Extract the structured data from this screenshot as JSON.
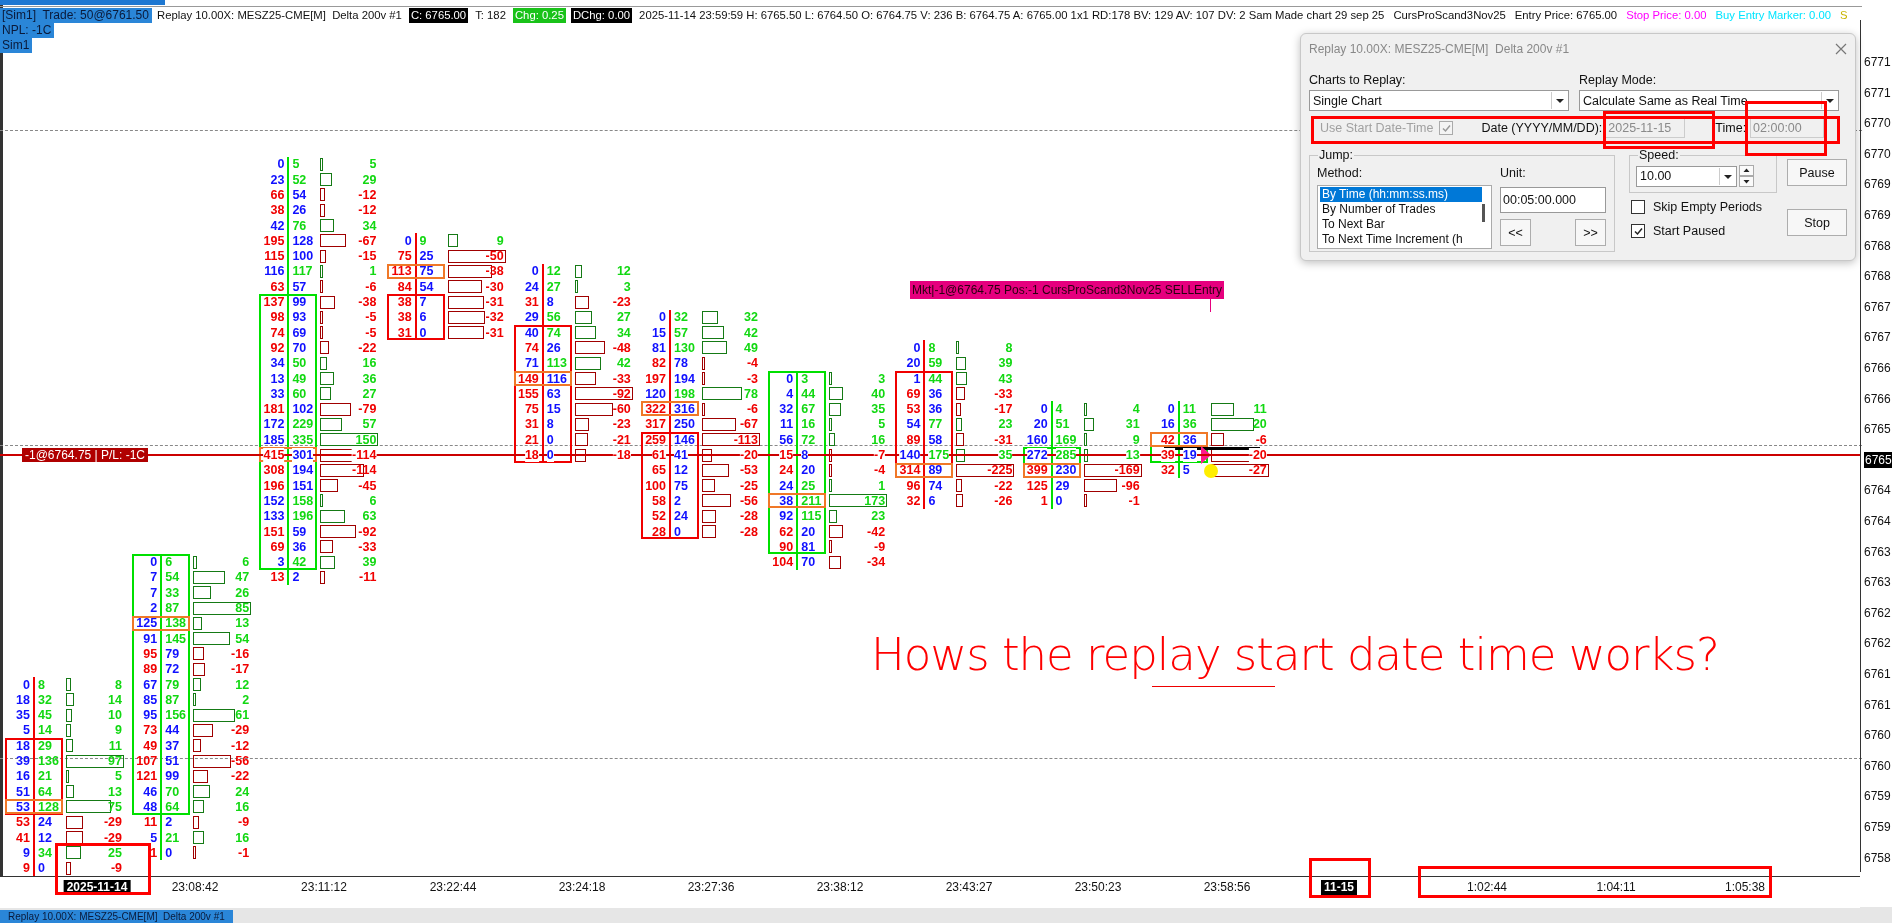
{
  "header": {
    "account": "[Sim1]  Trade: 50@6761.50",
    "npl": "NPL: -1C",
    "sim": "Sim1"
  },
  "info_line": [
    {
      "kind": "plain",
      "text": "Replay 10.00X: MESZ25-CME[M]  Delta 200v #1"
    },
    {
      "kind": "dark",
      "text": "C: 6765.00"
    },
    {
      "kind": "plain",
      "text": "T: 182"
    },
    {
      "kind": "up",
      "text": "Chg: 0.25"
    },
    {
      "kind": "dark",
      "text": "DChg: 0.00"
    },
    {
      "kind": "plain",
      "text": "2025-11-14 23:59:59 H: 6765.50 L: 6764.50 O: 6764.75 V: 236 B: 6764.75 A: 6765.00 1x1 RD:178 BV: 129 AV: 107 DV: 2 Sam Made chart 29 sep 25"
    },
    {
      "kind": "plain",
      "text": "CursProScand3Nov25"
    },
    {
      "kind": "plain",
      "text": "Entry Price: 6765.00"
    },
    {
      "kind": "tinted",
      "color": "#ff00ff",
      "text": "Stop Price: 0.00"
    },
    {
      "kind": "tinted",
      "color": "#00e5ff",
      "text": "Buy Entry Marker: 0.00"
    },
    {
      "kind": "tinted",
      "color": "#c8b400",
      "text": "S"
    }
  ],
  "price_axis": [
    {
      "kind": "label",
      "text": "6771"
    },
    {
      "kind": "label",
      "text": "6771"
    },
    {
      "kind": "label",
      "text": "6770"
    },
    {
      "kind": "label",
      "text": "6770"
    },
    {
      "kind": "label",
      "text": "6769"
    },
    {
      "kind": "label",
      "text": "6769"
    },
    {
      "kind": "label",
      "text": "6768"
    },
    {
      "kind": "label",
      "text": "6768"
    },
    {
      "kind": "label",
      "text": "6767"
    },
    {
      "kind": "label",
      "text": "6767"
    },
    {
      "kind": "label",
      "text": "6766"
    },
    {
      "kind": "label",
      "text": "6766"
    },
    {
      "kind": "label",
      "text": "6765"
    },
    {
      "kind": "current",
      "text": "6765"
    },
    {
      "kind": "label",
      "text": "6764"
    },
    {
      "kind": "label",
      "text": "6764"
    },
    {
      "kind": "label",
      "text": "6763"
    },
    {
      "kind": "label",
      "text": "6763"
    },
    {
      "kind": "label",
      "text": "6762"
    },
    {
      "kind": "label",
      "text": "6762"
    },
    {
      "kind": "label",
      "text": "6761"
    },
    {
      "kind": "label",
      "text": "6761"
    },
    {
      "kind": "label",
      "text": "6760"
    },
    {
      "kind": "label",
      "text": "6760"
    },
    {
      "kind": "label",
      "text": "6759"
    },
    {
      "kind": "label",
      "text": "6759"
    },
    {
      "kind": "label",
      "text": "6758"
    }
  ],
  "bars": [
    {
      "rising": false,
      "rows": [
        {
          "kind": "wick",
          "bid": "0",
          "ask": "8",
          "delta": "8"
        },
        {
          "kind": "wick",
          "bid": "18",
          "ask": "32",
          "delta": "14"
        },
        {
          "kind": "wick",
          "bid": "35",
          "ask": "45",
          "delta": "10"
        },
        {
          "kind": "wick",
          "bid": "5",
          "ask": "14",
          "delta": "9"
        },
        {
          "kind": "body",
          "bid": "18",
          "ask": "29",
          "delta": "11"
        },
        {
          "kind": "body",
          "bid": "39",
          "ask": "136",
          "delta": "97"
        },
        {
          "kind": "body",
          "bid": "16",
          "ask": "21",
          "delta": "5"
        },
        {
          "kind": "body",
          "bid": "51",
          "ask": "64",
          "delta": "13"
        },
        {
          "kind": "body_poc",
          "bid": "53",
          "ask": "128",
          "delta": "75"
        },
        {
          "kind": "wick",
          "bid": "53",
          "ask": "24",
          "delta": "-29"
        },
        {
          "kind": "wick",
          "bid": "41",
          "ask": "12",
          "delta": "-29"
        },
        {
          "kind": "wick",
          "bid": "9",
          "ask": "34",
          "delta": "25"
        },
        {
          "kind": "wick",
          "bid": "9",
          "ask": "0",
          "delta": "-9"
        }
      ]
    },
    {
      "rising": true,
      "rows": [
        {
          "kind": "body",
          "bid": "0",
          "ask": "6",
          "delta": "6"
        },
        {
          "kind": "body",
          "bid": "7",
          "ask": "54",
          "delta": "47"
        },
        {
          "kind": "body",
          "bid": "7",
          "ask": "33",
          "delta": "26"
        },
        {
          "kind": "body",
          "bid": "2",
          "ask": "87",
          "delta": "85"
        },
        {
          "kind": "body_poc",
          "bid": "125",
          "ask": "138",
          "delta": "13"
        },
        {
          "kind": "body",
          "bid": "91",
          "ask": "145",
          "delta": "54"
        },
        {
          "kind": "body",
          "bid": "95",
          "ask": "79",
          "delta": "-16"
        },
        {
          "kind": "body",
          "bid": "89",
          "ask": "72",
          "delta": "-17"
        },
        {
          "kind": "body",
          "bid": "67",
          "ask": "79",
          "delta": "12"
        },
        {
          "kind": "body",
          "bid": "85",
          "ask": "87",
          "delta": "2"
        },
        {
          "kind": "body",
          "bid": "95",
          "ask": "156",
          "delta": "61"
        },
        {
          "kind": "body",
          "bid": "73",
          "ask": "44",
          "delta": "-29"
        },
        {
          "kind": "body",
          "bid": "49",
          "ask": "37",
          "delta": "-12"
        },
        {
          "kind": "body",
          "bid": "107",
          "ask": "51",
          "delta": "-56"
        },
        {
          "kind": "body",
          "bid": "121",
          "ask": "99",
          "delta": "-22"
        },
        {
          "kind": "body",
          "bid": "46",
          "ask": "70",
          "delta": "24"
        },
        {
          "kind": "body",
          "bid": "48",
          "ask": "64",
          "delta": "16"
        },
        {
          "kind": "wick",
          "bid": "11",
          "ask": "2",
          "delta": "-9"
        },
        {
          "kind": "wick",
          "bid": "5",
          "ask": "21",
          "delta": "16"
        },
        {
          "kind": "wick",
          "bid": "1",
          "ask": "0",
          "delta": "-1"
        }
      ]
    },
    {
      "rising": true,
      "rows": [
        {
          "kind": "wick",
          "bid": "0",
          "ask": "5",
          "delta": "5"
        },
        {
          "kind": "wick",
          "bid": "23",
          "ask": "52",
          "delta": "29"
        },
        {
          "kind": "wick",
          "bid": "66",
          "ask": "54",
          "delta": "-12"
        },
        {
          "kind": "wick",
          "bid": "38",
          "ask": "26",
          "delta": "-12"
        },
        {
          "kind": "wick",
          "bid": "42",
          "ask": "76",
          "delta": "34"
        },
        {
          "kind": "wick",
          "bid": "195",
          "ask": "128",
          "delta": "-67"
        },
        {
          "kind": "wick",
          "bid": "115",
          "ask": "100",
          "delta": "-15"
        },
        {
          "kind": "wick",
          "bid": "116",
          "ask": "117",
          "delta": "1"
        },
        {
          "kind": "wick",
          "bid": "63",
          "ask": "57",
          "delta": "-6"
        },
        {
          "kind": "body",
          "bid": "137",
          "ask": "99",
          "delta": "-38"
        },
        {
          "kind": "body",
          "bid": "98",
          "ask": "93",
          "delta": "-5"
        },
        {
          "kind": "body",
          "bid": "74",
          "ask": "69",
          "delta": "-5"
        },
        {
          "kind": "body",
          "bid": "92",
          "ask": "70",
          "delta": "-22"
        },
        {
          "kind": "body",
          "bid": "34",
          "ask": "50",
          "delta": "16"
        },
        {
          "kind": "body",
          "bid": "13",
          "ask": "49",
          "delta": "36"
        },
        {
          "kind": "body",
          "bid": "33",
          "ask": "60",
          "delta": "27"
        },
        {
          "kind": "body",
          "bid": "181",
          "ask": "102",
          "delta": "-79"
        },
        {
          "kind": "body",
          "bid": "172",
          "ask": "229",
          "delta": "57"
        },
        {
          "kind": "body",
          "bid": "185",
          "ask": "335",
          "delta": "150"
        },
        {
          "kind": "body_poc",
          "bid": "415",
          "ask": "301",
          "delta": "-114"
        },
        {
          "kind": "body",
          "bid": "308",
          "ask": "194",
          "delta": "-114"
        },
        {
          "kind": "body",
          "bid": "196",
          "ask": "151",
          "delta": "-45"
        },
        {
          "kind": "body",
          "bid": "152",
          "ask": "158",
          "delta": "6"
        },
        {
          "kind": "body",
          "bid": "133",
          "ask": "196",
          "delta": "63"
        },
        {
          "kind": "body",
          "bid": "151",
          "ask": "59",
          "delta": "-92"
        },
        {
          "kind": "body",
          "bid": "69",
          "ask": "36",
          "delta": "-33"
        },
        {
          "kind": "body",
          "bid": "3",
          "ask": "42",
          "delta": "39"
        },
        {
          "kind": "wick",
          "bid": "13",
          "ask": "2",
          "delta": "-11"
        }
      ]
    },
    {
      "rising": false,
      "rows": [
        {
          "kind": "wick",
          "bid": "0",
          "ask": "9",
          "delta": "9"
        },
        {
          "kind": "wick",
          "bid": "75",
          "ask": "25",
          "delta": "-50"
        },
        {
          "kind": "poc",
          "bid": "113",
          "ask": "75",
          "delta": "-38"
        },
        {
          "kind": "wick",
          "bid": "84",
          "ask": "54",
          "delta": "-30"
        },
        {
          "kind": "body",
          "bid": "38",
          "ask": "7",
          "delta": "-31"
        },
        {
          "kind": "body",
          "bid": "38",
          "ask": "6",
          "delta": "-32"
        },
        {
          "kind": "body",
          "bid": "31",
          "ask": "0",
          "delta": "-31"
        }
      ]
    },
    {
      "rising": false,
      "rows": [
        {
          "kind": "wick",
          "bid": "0",
          "ask": "12",
          "delta": "12"
        },
        {
          "kind": "wick",
          "bid": "24",
          "ask": "27",
          "delta": "3"
        },
        {
          "kind": "wick",
          "bid": "31",
          "ask": "8",
          "delta": "-23"
        },
        {
          "kind": "wick",
          "bid": "29",
          "ask": "56",
          "delta": "27"
        },
        {
          "kind": "body",
          "bid": "40",
          "ask": "74",
          "delta": "34"
        },
        {
          "kind": "body",
          "bid": "74",
          "ask": "26",
          "delta": "-48"
        },
        {
          "kind": "body",
          "bid": "71",
          "ask": "113",
          "delta": "42"
        },
        {
          "kind": "body_poc",
          "bid": "149",
          "ask": "116",
          "delta": "-33"
        },
        {
          "kind": "body",
          "bid": "155",
          "ask": "63",
          "delta": "-92"
        },
        {
          "kind": "body",
          "bid": "75",
          "ask": "15",
          "delta": "-60"
        },
        {
          "kind": "body",
          "bid": "31",
          "ask": "8",
          "delta": "-23"
        },
        {
          "kind": "body",
          "bid": "21",
          "ask": "0",
          "delta": "-21"
        },
        {
          "kind": "body",
          "bid": "18",
          "ask": "0",
          "delta": "-18"
        }
      ]
    },
    {
      "rising": false,
      "rows": [
        {
          "kind": "wick",
          "bid": "0",
          "ask": "32",
          "delta": "32"
        },
        {
          "kind": "wick",
          "bid": "15",
          "ask": "57",
          "delta": "42"
        },
        {
          "kind": "wick",
          "bid": "81",
          "ask": "130",
          "delta": "49"
        },
        {
          "kind": "wick",
          "bid": "82",
          "ask": "78",
          "delta": "-4"
        },
        {
          "kind": "wick",
          "bid": "197",
          "ask": "194",
          "delta": "-3"
        },
        {
          "kind": "wick",
          "bid": "120",
          "ask": "198",
          "delta": "78"
        },
        {
          "kind": "poc",
          "bid": "322",
          "ask": "316",
          "delta": "-6"
        },
        {
          "kind": "wick",
          "bid": "317",
          "ask": "250",
          "delta": "-67"
        },
        {
          "kind": "body",
          "bid": "259",
          "ask": "146",
          "delta": "-113"
        },
        {
          "kind": "body",
          "bid": "61",
          "ask": "41",
          "delta": "-20"
        },
        {
          "kind": "body",
          "bid": "65",
          "ask": "12",
          "delta": "-53"
        },
        {
          "kind": "body",
          "bid": "100",
          "ask": "75",
          "delta": "-25"
        },
        {
          "kind": "body",
          "bid": "58",
          "ask": "2",
          "delta": "-56"
        },
        {
          "kind": "body",
          "bid": "52",
          "ask": "24",
          "delta": "-28"
        },
        {
          "kind": "body",
          "bid": "28",
          "ask": "0",
          "delta": "-28"
        }
      ]
    },
    {
      "rising": true,
      "rows": [
        {
          "kind": "body",
          "bid": "0",
          "ask": "3",
          "delta": "3"
        },
        {
          "kind": "body",
          "bid": "4",
          "ask": "44",
          "delta": "40"
        },
        {
          "kind": "body",
          "bid": "32",
          "ask": "67",
          "delta": "35"
        },
        {
          "kind": "body",
          "bid": "11",
          "ask": "16",
          "delta": "5"
        },
        {
          "kind": "body",
          "bid": "56",
          "ask": "72",
          "delta": "16"
        },
        {
          "kind": "body",
          "bid": "15",
          "ask": "8",
          "delta": "-7"
        },
        {
          "kind": "body",
          "bid": "24",
          "ask": "20",
          "delta": "-4"
        },
        {
          "kind": "body",
          "bid": "24",
          "ask": "25",
          "delta": "1"
        },
        {
          "kind": "body_poc",
          "bid": "38",
          "ask": "211",
          "delta": "173"
        },
        {
          "kind": "body",
          "bid": "92",
          "ask": "115",
          "delta": "23"
        },
        {
          "kind": "body",
          "bid": "62",
          "ask": "20",
          "delta": "-42"
        },
        {
          "kind": "body",
          "bid": "90",
          "ask": "81",
          "delta": "-9"
        },
        {
          "kind": "wick",
          "bid": "104",
          "ask": "70",
          "delta": "-34"
        }
      ]
    },
    {
      "rising": false,
      "rows": [
        {
          "kind": "wick",
          "bid": "0",
          "ask": "8",
          "delta": "8"
        },
        {
          "kind": "wick",
          "bid": "20",
          "ask": "59",
          "delta": "39"
        },
        {
          "kind": "body",
          "bid": "1",
          "ask": "44",
          "delta": "43"
        },
        {
          "kind": "body",
          "bid": "69",
          "ask": "36",
          "delta": "-33"
        },
        {
          "kind": "body",
          "bid": "53",
          "ask": "36",
          "delta": "-17"
        },
        {
          "kind": "body",
          "bid": "54",
          "ask": "77",
          "delta": "23"
        },
        {
          "kind": "body",
          "bid": "89",
          "ask": "58",
          "delta": "-31"
        },
        {
          "kind": "body",
          "bid": "140",
          "ask": "175",
          "delta": "35"
        },
        {
          "kind": "body_poc",
          "bid": "314",
          "ask": "89",
          "delta": "-225"
        },
        {
          "kind": "wick",
          "bid": "96",
          "ask": "74",
          "delta": "-22"
        },
        {
          "kind": "wick",
          "bid": "32",
          "ask": "6",
          "delta": "-26"
        }
      ]
    },
    {
      "rising": true,
      "rows": [
        {
          "kind": "wick",
          "bid": "0",
          "ask": "4",
          "delta": "4"
        },
        {
          "kind": "wick",
          "bid": "20",
          "ask": "51",
          "delta": "31"
        },
        {
          "kind": "wick",
          "bid": "160",
          "ask": "169",
          "delta": "9"
        },
        {
          "kind": "body",
          "bid": "272",
          "ask": "285",
          "delta": "13"
        },
        {
          "kind": "body_poc",
          "bid": "399",
          "ask": "230",
          "delta": "-169"
        },
        {
          "kind": "wick",
          "bid": "125",
          "ask": "29",
          "delta": "-96"
        },
        {
          "kind": "wick",
          "bid": "1",
          "ask": "0",
          "delta": "-1"
        }
      ]
    },
    {
      "rising": true,
      "rows": [
        {
          "kind": "wick",
          "bid": "0",
          "ask": "11",
          "delta": "11"
        },
        {
          "kind": "wick",
          "bid": "16",
          "ask": "36",
          "delta": "20"
        },
        {
          "kind": "body_poc",
          "bid": "42",
          "ask": "36",
          "delta": "-6"
        },
        {
          "kind": "body",
          "bid": "39",
          "ask": "19",
          "delta": "-20"
        },
        {
          "kind": "wick",
          "bid": "32",
          "ask": "5",
          "delta": "-27"
        }
      ]
    }
  ],
  "position_label": "-1@6764.75 | P/L: -1C",
  "order_label": "Mkt|-1@6764.75 Pos:-1 CursProScand3Nov25 SELLEntry",
  "time_axis": [
    {
      "kind": "date",
      "text": "2025-11-14"
    },
    {
      "kind": "time",
      "text": "23:08:42"
    },
    {
      "kind": "time",
      "text": "23:11:12"
    },
    {
      "kind": "time",
      "text": "23:22:44"
    },
    {
      "kind": "time",
      "text": "23:24:18"
    },
    {
      "kind": "time",
      "text": "23:27:36"
    },
    {
      "kind": "time",
      "text": "23:38:12"
    },
    {
      "kind": "time",
      "text": "23:43:27"
    },
    {
      "kind": "time",
      "text": "23:50:23"
    },
    {
      "kind": "time",
      "text": "23:58:56"
    },
    {
      "kind": "date",
      "text": "11-15"
    },
    {
      "kind": "time",
      "text": "1:02:44"
    },
    {
      "kind": "time",
      "text": "1:04:11"
    },
    {
      "kind": "time",
      "text": "1:05:38"
    }
  ],
  "annotation": "Hows the replay start date time works?",
  "dialog": {
    "title": "Replay 10.00X: MESZ25-CME[M]  Delta 200v #1",
    "charts_label": "Charts to Replay:",
    "charts_value": "Single Chart",
    "mode_label": "Replay Mode:",
    "mode_value": "Calculate Same as Real Time",
    "use_start": {
      "label": "Use Start Date-Time",
      "checked": true,
      "disabled": true
    },
    "date_label": "Date (YYYY/MM/DD):",
    "date_value": "2025-11-15",
    "time_label": "Time:",
    "time_value": "02:00:00",
    "jump_label": "Jump:",
    "method_label": "Method:",
    "methods": [
      {
        "label": "By Time (hh:mm:ss.ms)",
        "selected": true
      },
      {
        "label": "By Number of Trades",
        "selected": false
      },
      {
        "label": "To Next Bar",
        "selected": false
      },
      {
        "label": "To Next Time Increment (h",
        "selected": false
      }
    ],
    "unit_label": "Unit:",
    "unit_value": "00:05:00.000",
    "back_button": "<<",
    "forward_button": ">>",
    "speed_label": "Speed:",
    "speed_value": "10.00",
    "pause_button": "Pause",
    "stop_button": "Stop",
    "skip_empty": {
      "label": "Skip Empty Periods",
      "checked": false
    },
    "start_paused": {
      "label": "Start Paused",
      "checked": true
    }
  },
  "taskbar_tab": "Replay 10.00X: MESZ25-CME[M]  Delta 200v #1"
}
